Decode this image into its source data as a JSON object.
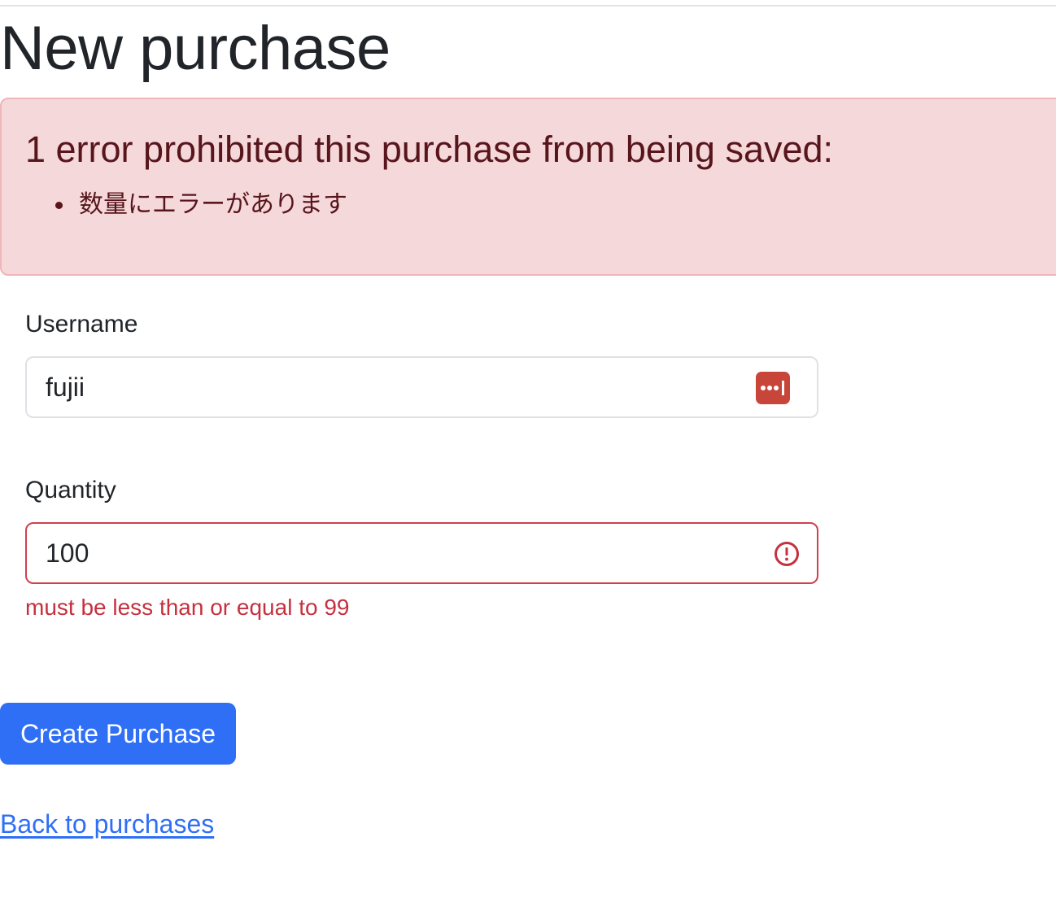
{
  "page": {
    "title": "New purchase"
  },
  "errors": {
    "heading": "1 error prohibited this purchase from being saved:",
    "messages": [
      "数量にエラーがあります"
    ]
  },
  "form": {
    "username": {
      "label": "Username",
      "value": "fujii",
      "icon": "password-manager-icon"
    },
    "quantity": {
      "label": "Quantity",
      "value": "100",
      "icon": "error-icon",
      "feedback": "must be less than or equal to 99"
    },
    "submit_label": "Create Purchase"
  },
  "links": {
    "back": "Back to purchases"
  },
  "colors": {
    "primary": "#2f6ff6",
    "danger": "#c6303e",
    "alert_bg": "#f4d8da",
    "alert_text": "#58151c"
  }
}
